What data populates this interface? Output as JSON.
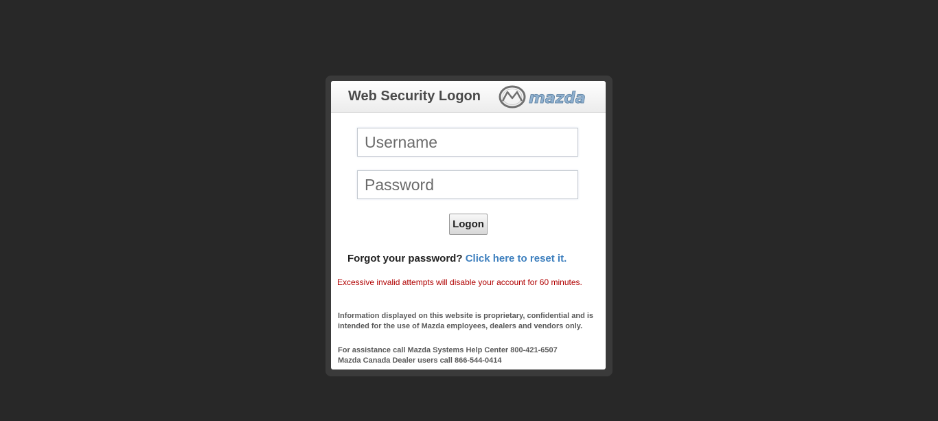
{
  "header": {
    "title": "Web Security Logon",
    "logo_text": "mazda"
  },
  "form": {
    "username_placeholder": "Username",
    "password_placeholder": "Password",
    "logon_label": "Logon"
  },
  "forgot": {
    "question": "Forgot your password?",
    "link_text": "Click here to reset it."
  },
  "warning": "Excessive invalid attempts will disable your account for 60 minutes.",
  "info": "Information displayed on this website is proprietary, confidential and is intended for the use of Mazda employees, dealers and vendors only.",
  "assist": {
    "line1": "For assistance call Mazda Systems Help Center 800-421-6507",
    "line2": "Mazda Canada Dealer users call 866-544-0414"
  },
  "colors": {
    "background": "#282828",
    "link": "#3d7fbe",
    "warning": "#b00000"
  }
}
